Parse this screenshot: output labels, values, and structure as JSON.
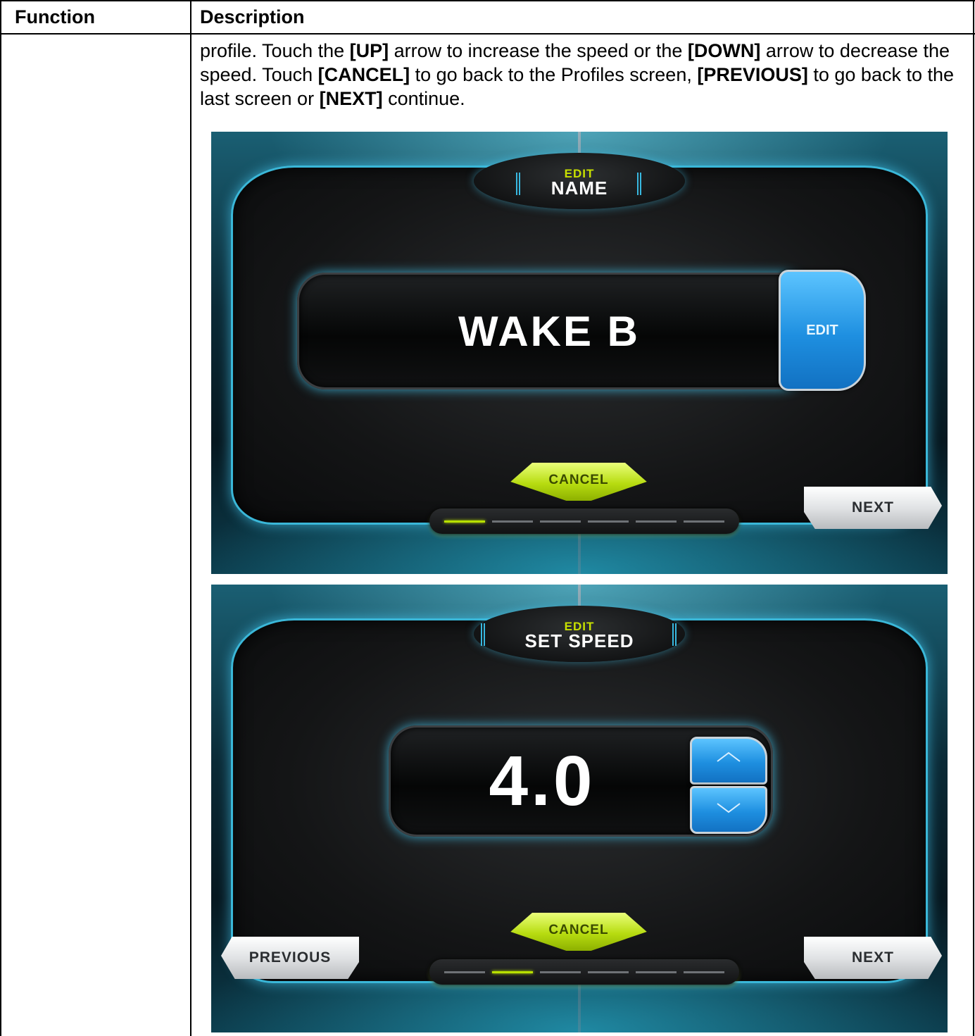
{
  "table": {
    "header_function": "Function",
    "header_description": "Description"
  },
  "description": {
    "p1": "profile. Touch the ",
    "b1": "[UP]",
    "p2": " arrow to increase the speed or the ",
    "b2": "[DOWN]",
    "p3": " arrow to decrease the speed. Touch ",
    "b3": "[CANCEL]",
    "p4": " to go back to the Profiles screen, ",
    "b4": "[PREVIOUS]",
    "p5": " to go back to the last screen or ",
    "b5": "[NEXT]",
    "p6": " continue."
  },
  "screen1": {
    "title_small": "EDIT",
    "title_main": "NAME",
    "field_value": "WAKE B",
    "edit_button": "EDIT",
    "cancel_button": "CANCEL",
    "next_button": "NEXT",
    "progress_total": 6,
    "progress_active": 1
  },
  "screen2": {
    "title_small": "EDIT",
    "title_main": "SET SPEED",
    "field_value": "4.0",
    "up_icon": "chevron-up-icon",
    "down_icon": "chevron-down-icon",
    "cancel_button": "CANCEL",
    "previous_button": "PREVIOUS",
    "next_button": "NEXT",
    "progress_total": 6,
    "progress_active": 2
  },
  "colors": {
    "accent_green": "#b8e000",
    "accent_blue": "#1e8fe0",
    "glow_cyan": "#3ab7d8"
  }
}
